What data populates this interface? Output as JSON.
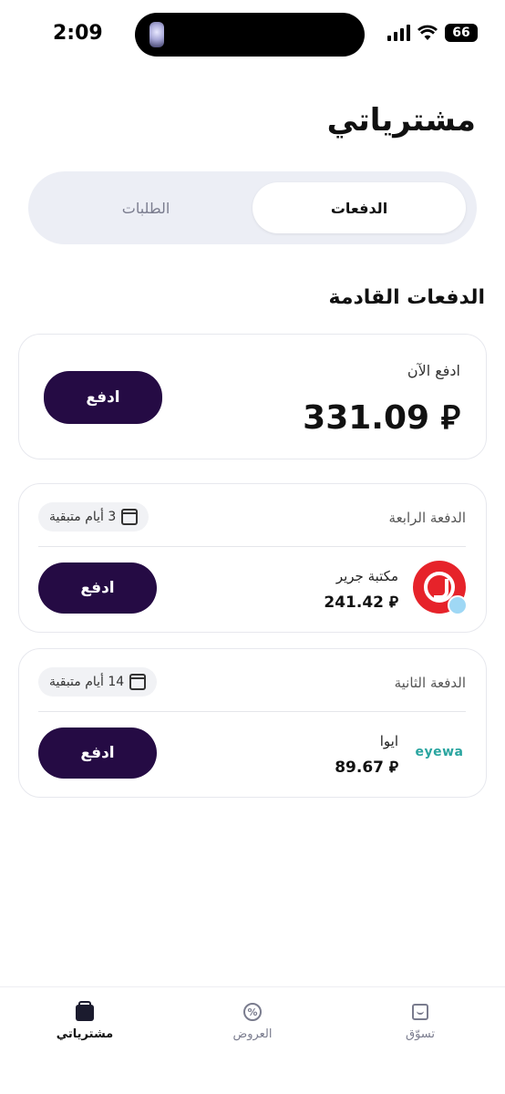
{
  "status_bar": {
    "time": "2:09",
    "battery": "66"
  },
  "header": {
    "title": "مشترياتي"
  },
  "tabs": {
    "active": "الدفعات",
    "inactive": "الطلبات"
  },
  "section": {
    "title": "الدفعات القادمة"
  },
  "pay_now": {
    "label": "ادفع الآن",
    "amount": "331.09 ⃁",
    "button": "ادفع"
  },
  "installments": [
    {
      "label": "الدفعة الرابعة",
      "days_left": "3 أيام متبقية",
      "merchant": "مكتبة جرير",
      "amount": "241.42 ⃁",
      "button": "ادفع",
      "logo_icon": "jarir-logo",
      "logo_color": "#e6232a"
    },
    {
      "label": "الدفعة الثانية",
      "days_left": "14 أيام متبقية",
      "merchant": "ايوا",
      "amount": "89.67 ⃁",
      "button": "ادفع",
      "logo_text": "eyewa",
      "logo_icon": "eyewa-logo",
      "logo_color": "#2aa5a0"
    }
  ],
  "bottom_nav": [
    {
      "label": "مشترياتي",
      "icon": "bag-icon",
      "active": true
    },
    {
      "label": "العروض",
      "icon": "offer-icon",
      "active": false
    },
    {
      "label": "تسوّق",
      "icon": "home-icon",
      "active": false
    }
  ],
  "colors": {
    "accent": "#250b44",
    "background": "#ffffff",
    "segment_bg": "#eceef5"
  }
}
